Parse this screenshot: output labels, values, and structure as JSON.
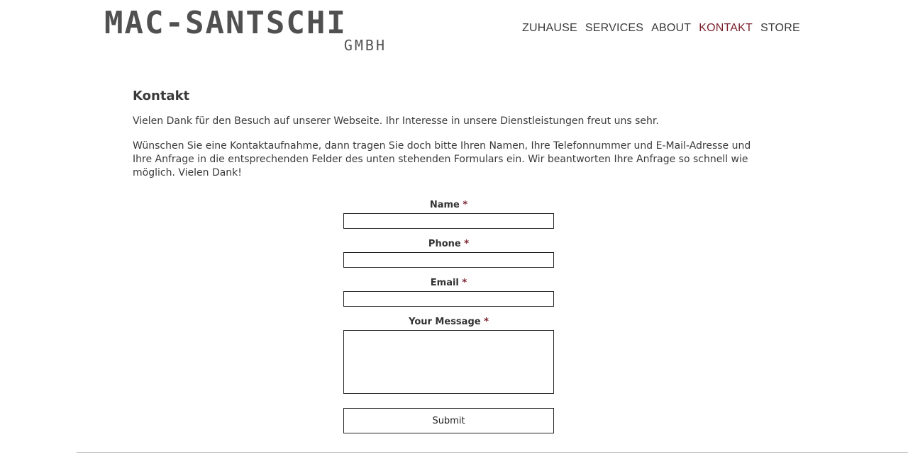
{
  "header": {
    "logo_main": "MAC-SANTSCHI",
    "logo_sub": "GMBH",
    "nav": [
      {
        "label": "ZUHAUSE"
      },
      {
        "label": "SERVICES"
      },
      {
        "label": "ABOUT"
      },
      {
        "label": "KONTAKT",
        "active": true
      },
      {
        "label": "STORE"
      }
    ],
    "active_color": "#7a1f2b"
  },
  "main": {
    "title": "Kontakt",
    "paragraph1": "Vielen Dank für den Besuch auf unserer Webseite. Ihr Interesse in unsere Dienstleistungen freut uns sehr.",
    "paragraph2": "Wünschen Sie eine Kontaktaufnahme, dann tragen Sie doch bitte Ihren Namen, Ihre Telefonnummer und E-Mail-Adresse und Ihre Anfrage in die entsprechenden Felder des unten stehenden Formulars ein. Wir beantworten Ihre Anfrage so schnell wie möglich. Vielen Dank!"
  },
  "form": {
    "required_marker": "*",
    "name_label": "Name",
    "name_value": "",
    "phone_label": "Phone",
    "phone_value": "",
    "email_label": "Email",
    "email_value": "",
    "message_label": "Your Message",
    "message_value": "",
    "submit_label": "Submit"
  }
}
